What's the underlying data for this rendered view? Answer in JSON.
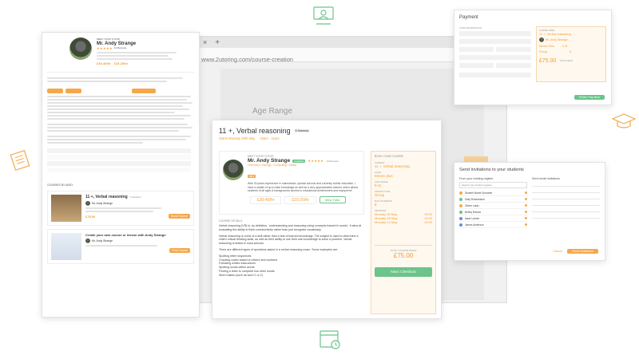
{
  "browser": {
    "url": "www.2utoring.com/course-creation",
    "new_tab": "+",
    "close_tab": "×"
  },
  "bg_panel": {
    "heading": "Age Range"
  },
  "main_card": {
    "title": "11 +, Verbal reasoning",
    "badge": "5 Sessions",
    "schedule": "Starts Monday 30th May",
    "time": "10am - 11am",
    "tutor_label": "MEET YOUR TUTOR",
    "tutor_name": "Mr. Andy Strange",
    "tutor_status": "Available",
    "tutor_rating": "★★★★★",
    "tutor_reviews": "10 Reviews",
    "tutor_subjects": "Chemistry • Biology • Computing • Maths",
    "tutor_tag": "DBS",
    "tutor_bio": "With 25 years experience in mainstream, special schools and currently further education, I have a wealth of up-to-date knowledge as well as a very approachable manner which allows students of all ages & backgrounds access to educational achievement and enjoyment!",
    "price_1": "£30-40/hr",
    "price_2": "£15-20/hr",
    "view_tutor": "View Tutor",
    "course_details_label": "COURSE DETAILS",
    "para_1": "Verbal reasoning (VR) is, by definition, 'understanding and reasoning using concepts framed in words'. It aims at evaluating the ability to think constructively rather than just recognise vocabulary.",
    "para_2": "Verbal reasoning is a test of a skill rather than a test of learned knowledge. The subject is used to determine a child's critical thinking skills, as well as their ability to use their own knowledge to solve a problem. Verbal reasoning is tested in most schools.",
    "para_3": "There are different types of questions asked in a verbal reasoning exam. Some examples are:",
    "list": [
      "Spotting letter sequences",
      "Cracking codes based on letters and numbers",
      "Following written instructions",
      "Spotting words within words",
      "Finding a letter to complete two other words",
      "Word makes (such as word 1 or 2)"
    ],
    "side": {
      "title": "BOOK YOUR COURSE",
      "subject_label": "SUBJECT",
      "subject": "11 +, Verbal reasoning",
      "level_label": "LEVEL",
      "level": "Eleven plus",
      "age_label": "AGE RANGE",
      "age": "9-11",
      "type_label": "LESSON TYPE",
      "type": "Group",
      "students_label": "MAX STUDENTS",
      "students": "8",
      "sessions_label": "SESSIONS",
      "dates": [
        {
          "left": "Monday 30 May",
          "right": "19:00"
        },
        {
          "left": "Monday 06 May",
          "right": "19:00"
        },
        {
          "left": "Monday 13 May",
          "right": "19:00"
        }
      ],
      "total_label": "TOTAL COURSE PRICE",
      "total": "£75.00",
      "checkout": "Next: Checkout"
    }
  },
  "left_card": {
    "tutor_label": "MEET YOUR TUTOR",
    "tutor_name": "Mr. Andy Strange",
    "tutor_rating": "★★★★★",
    "tutor_reviews": "10 Reviews",
    "price_1": "£30-40/hr",
    "price_2": "£15-20/hr",
    "courses_label": "COURSES BY ANDY",
    "course_title": "11 +, Verbal reasoning",
    "course_badge": "5 Sessions",
    "course_tutor": "Mr. Andy Strange",
    "course_price": "£75.00",
    "course_btn": "Book Course",
    "create_title": "Create your own course or lesson with Andy Strange",
    "create_tutor": "Mr. Andy Strange",
    "create_btn": "Find Course"
  },
  "payment": {
    "title": "Payment",
    "section_label": "CARD INFORMATION",
    "subject_label": "COURSE NAME",
    "subject": "11 +, Verbal reasoning",
    "tutor": "Mr. Andy Strange",
    "level": "Eleven Plus",
    "age": "9-11",
    "type": "Group",
    "students": "8",
    "price": "£75.00",
    "price_note": "TOTAL PRICE",
    "pay_btn": "Finish: Pay Now"
  },
  "invite": {
    "title": "Send invitations to your students",
    "from_label": "From your existing register",
    "email_label": "Send email invitations",
    "search_placeholder": "Search your student register...",
    "students": [
      {
        "name": "Student Name Surname",
        "color": "#f5a84a"
      },
      {
        "name": "Sally Rosenbaum",
        "color": "#6cc48a"
      },
      {
        "name": "Olivier Lantz",
        "color": "#f5a84a"
      },
      {
        "name": "Bobby Ramos",
        "color": "#6cc48a"
      },
      {
        "name": "Isaac Larsen",
        "color": "#6b8fd6"
      },
      {
        "name": "James Anderson",
        "color": "#6b8fd6"
      }
    ],
    "cancel": "Cancel",
    "send": "Send invitations"
  }
}
